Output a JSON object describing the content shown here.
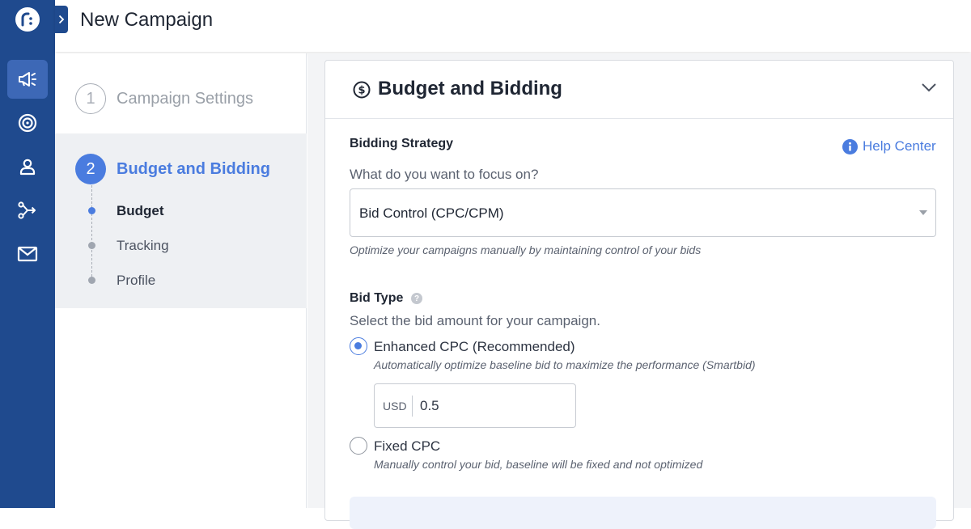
{
  "header": {
    "title": "New Campaign"
  },
  "steps": [
    {
      "number": "1",
      "label": "Campaign Settings"
    },
    {
      "number": "2",
      "label": "Budget and Bidding",
      "substeps": [
        "Budget",
        "Tracking",
        "Profile"
      ]
    }
  ],
  "card": {
    "title": "Budget and Bidding",
    "bidding_strategy": {
      "label": "Bidding Strategy",
      "help_link": "Help Center",
      "question": "What do you want to focus on?",
      "selected": "Bid Control (CPC/CPM)",
      "hint": "Optimize your campaigns manually by maintaining control of your bids"
    },
    "bid_type": {
      "label": "Bid Type",
      "question": "Select the bid amount for your campaign.",
      "options": [
        {
          "label": "Enhanced CPC (Recommended)",
          "hint": "Automatically optimize baseline bid to maximize the performance (Smartbid)",
          "checked": true
        },
        {
          "label": "Fixed CPC",
          "hint": "Manually control your bid, baseline will be fixed and not optimized",
          "checked": false
        }
      ],
      "currency": "USD",
      "amount": "0.5"
    }
  },
  "colors": {
    "rail": "#1f4a8e",
    "accent": "#4a7cdf"
  },
  "icons": [
    "logo-icon",
    "megaphone-icon",
    "target-icon",
    "person-icon",
    "flow-icon",
    "mail-icon",
    "chevron-right-icon",
    "dollar-icon",
    "chevron-down-icon",
    "info-icon",
    "question-icon",
    "dropdown-arrow-icon"
  ]
}
